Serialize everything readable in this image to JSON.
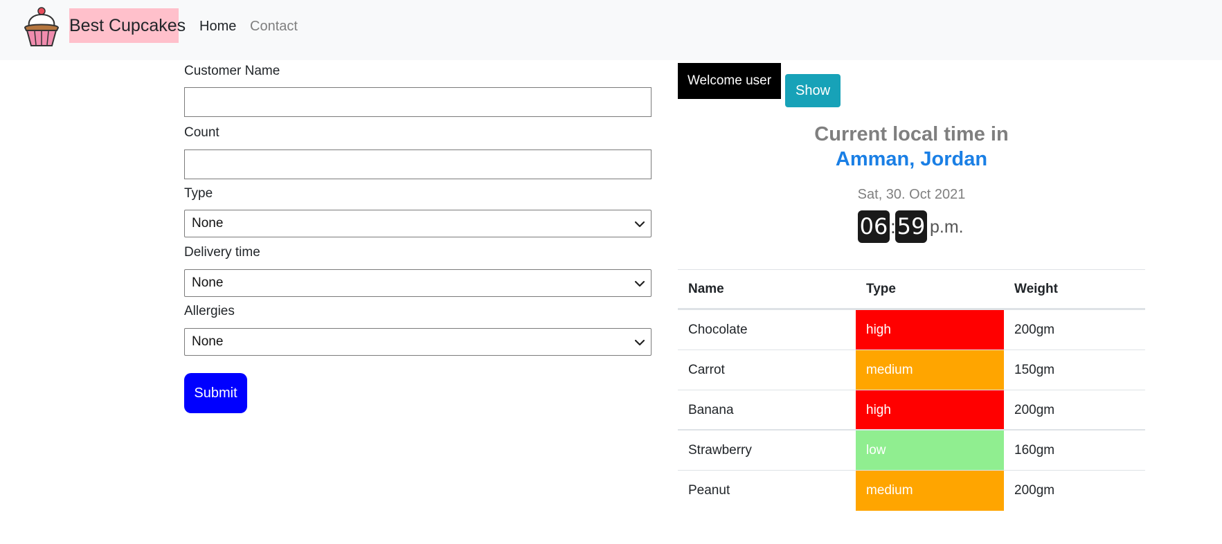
{
  "navbar": {
    "brand": "Best Cupcakes",
    "links": {
      "home": "Home",
      "contact": "Contact"
    },
    "logo_icon": "cupcake-icon"
  },
  "form": {
    "customer_name": {
      "label": "Customer Name",
      "value": "",
      "placeholder": ""
    },
    "count": {
      "label": "Count",
      "value": "",
      "placeholder": ""
    },
    "type": {
      "label": "Type",
      "selected": "None"
    },
    "delivery_time": {
      "label": "Delivery time",
      "selected": "None"
    },
    "allergies": {
      "label": "Allergies",
      "selected": "None"
    },
    "submit_label": "Submit"
  },
  "welcome": {
    "text": "Welcome user",
    "show_label": "Show"
  },
  "clock": {
    "title_line1": "Current local time in",
    "title_line2": "Amman, Jordan",
    "date": "Sat, 30. Oct 2021",
    "hours": "06",
    "separator": ":",
    "minutes": "59",
    "ampm": "p.m."
  },
  "table": {
    "headers": {
      "name": "Name",
      "type": "Type",
      "weight": "Weight"
    },
    "rows": [
      {
        "name": "Chocolate",
        "type": "high",
        "weight": "200gm",
        "color": "#ff0000"
      },
      {
        "name": "Carrot",
        "type": "medium",
        "weight": "150gm",
        "color": "#ffa500"
      },
      {
        "name": "Banana",
        "type": "high",
        "weight": "200gm",
        "color": "#ff0000"
      },
      {
        "name": "Strawberry",
        "type": "low",
        "weight": "160gm",
        "color": "#90ee90"
      },
      {
        "name": "Peanut",
        "type": "medium",
        "weight": "200gm",
        "color": "#ffa500"
      }
    ]
  },
  "colors": {
    "navbar_bg": "#f8f9fa",
    "brand_bg": "#ffc0cb",
    "submit_bg": "#0000ff",
    "show_bg": "#17a2b8",
    "city_link": "#1a7fe5"
  }
}
